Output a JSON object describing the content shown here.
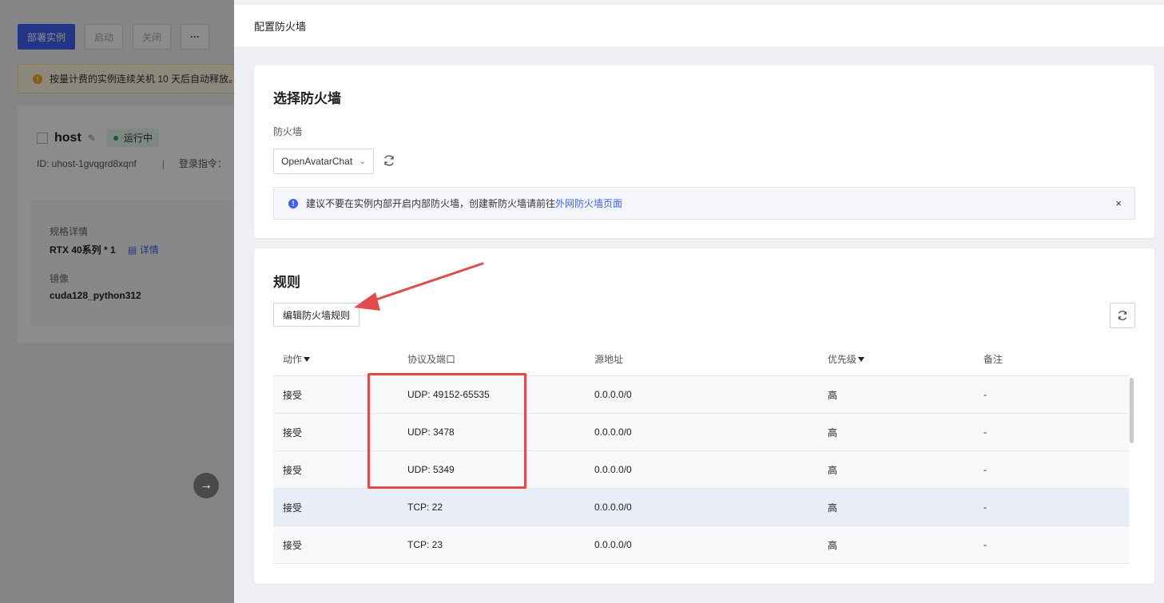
{
  "background": {
    "buttons": {
      "deploy": "部署实例",
      "start": "启动",
      "stop": "关闭",
      "more": "···"
    },
    "warning": "按量计费的实例连续关机 10 天后自动释放。",
    "host": {
      "name": "host",
      "status": "运行中",
      "id": "ID: uhost-1gvqgrd8xqnf",
      "separator": "|",
      "login_cmd": "登录指令：",
      "spec_label": "规格详情",
      "spec_value": "RTX 40系列 * 1",
      "detail_link": "详情",
      "image_label": "镜像",
      "image_value": "cuda128_python312"
    },
    "arrow_icon": "→"
  },
  "drawer": {
    "title": "配置防火墙",
    "firewall_section": {
      "title": "选择防火墙",
      "field_label": "防火墙",
      "selected": "OpenAvatarChat",
      "notice_text": "建议不要在实例内部开启内部防火墙，创建新防火墙请前往",
      "notice_link": "外网防火墙页面",
      "notice_close": "×"
    },
    "rules_section": {
      "title": "规则",
      "edit_button": "编辑防火墙规则",
      "columns": [
        "动作",
        "协议及端口",
        "源地址",
        "优先级",
        "备注"
      ],
      "rows": [
        {
          "action": "接受",
          "proto": "UDP: 49152-65535",
          "source": "0.0.0.0/0",
          "priority": "高",
          "note": "-"
        },
        {
          "action": "接受",
          "proto": "UDP: 3478",
          "source": "0.0.0.0/0",
          "priority": "高",
          "note": "-"
        },
        {
          "action": "接受",
          "proto": "UDP: 5349",
          "source": "0.0.0.0/0",
          "priority": "高",
          "note": "-"
        },
        {
          "action": "接受",
          "proto": "TCP: 22",
          "source": "0.0.0.0/0",
          "priority": "高",
          "note": "-"
        },
        {
          "action": "接受",
          "proto": "TCP: 23",
          "source": "0.0.0.0/0",
          "priority": "高",
          "note": "-"
        }
      ]
    }
  },
  "colors": {
    "primary": "#3e62f5",
    "annotation": "#e24b4b",
    "running": "#1cb35b"
  },
  "icons": [
    "info-icon",
    "refresh-icon",
    "chevron-down-icon",
    "filter-icon",
    "close-icon",
    "edit-icon",
    "document-icon",
    "arrow-right-icon"
  ]
}
